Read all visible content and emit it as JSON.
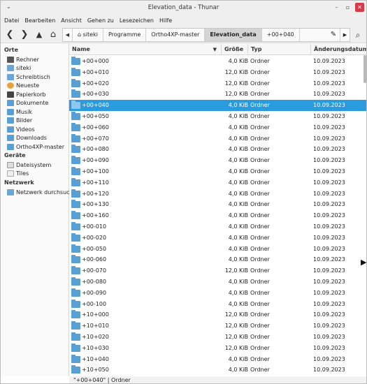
{
  "window": {
    "title": "Elevation_data - Thunar"
  },
  "menu": [
    "Datei",
    "Bearbeiten",
    "Ansicht",
    "Gehen zu",
    "Lesezeichen",
    "Hilfe"
  ],
  "toolbar": {
    "back_icon": "back-icon",
    "forward_icon": "forward-icon",
    "up_icon": "up-icon",
    "home_icon": "home-icon",
    "path": [
      {
        "label": "siteki",
        "icon": "home-small-icon"
      },
      {
        "label": "Programme"
      },
      {
        "label": "Ortho4XP-master"
      },
      {
        "label": "Elevation_data",
        "active": true
      },
      {
        "label": "+00+040"
      }
    ],
    "search_icon": "search-icon"
  },
  "sidebar": {
    "sections": [
      {
        "title": "Orte",
        "items": [
          {
            "label": "Rechner",
            "icon": "computer-icon"
          },
          {
            "label": "siteki",
            "icon": "home-folder-icon"
          },
          {
            "label": "Schreibtisch",
            "icon": "desktop-icon"
          },
          {
            "label": "Neueste",
            "icon": "recent-icon"
          },
          {
            "label": "Papierkorb",
            "icon": "trash-icon"
          },
          {
            "label": "Dokumente",
            "icon": "folder-icon"
          },
          {
            "label": "Musik",
            "icon": "folder-icon"
          },
          {
            "label": "Bilder",
            "icon": "folder-icon"
          },
          {
            "label": "Videos",
            "icon": "folder-icon"
          },
          {
            "label": "Downloads",
            "icon": "folder-icon"
          },
          {
            "label": "Ortho4XP-master",
            "icon": "folder-icon"
          }
        ]
      },
      {
        "title": "Geräte",
        "items": [
          {
            "label": "Dateisystem",
            "icon": "drive-icon"
          },
          {
            "label": "Tiles",
            "icon": "drive-icon"
          }
        ]
      },
      {
        "title": "Netzwerk",
        "items": [
          {
            "label": "Netzwerk durchsuc...",
            "icon": "network-icon"
          }
        ]
      }
    ]
  },
  "columns": [
    "Name",
    "Größe",
    "Typ",
    "Änderungsdatum"
  ],
  "rows": [
    {
      "name": "+00+000",
      "size": "4,0 KiB",
      "type": "Ordner",
      "date": "10.09.2023"
    },
    {
      "name": "+00+010",
      "size": "12,0 KiB",
      "type": "Ordner",
      "date": "10.09.2023"
    },
    {
      "name": "+00+020",
      "size": "12,0 KiB",
      "type": "Ordner",
      "date": "10.09.2023"
    },
    {
      "name": "+00+030",
      "size": "12,0 KiB",
      "type": "Ordner",
      "date": "10.09.2023"
    },
    {
      "name": "+00+040",
      "size": "4,0 KiB",
      "type": "Ordner",
      "date": "10.09.2023",
      "selected": true
    },
    {
      "name": "+00+050",
      "size": "4,0 KiB",
      "type": "Ordner",
      "date": "10.09.2023"
    },
    {
      "name": "+00+060",
      "size": "4,0 KiB",
      "type": "Ordner",
      "date": "10.09.2023"
    },
    {
      "name": "+00+070",
      "size": "4,0 KiB",
      "type": "Ordner",
      "date": "10.09.2023"
    },
    {
      "name": "+00+080",
      "size": "4,0 KiB",
      "type": "Ordner",
      "date": "10.09.2023"
    },
    {
      "name": "+00+090",
      "size": "4,0 KiB",
      "type": "Ordner",
      "date": "10.09.2023"
    },
    {
      "name": "+00+100",
      "size": "4,0 KiB",
      "type": "Ordner",
      "date": "10.09.2023"
    },
    {
      "name": "+00+110",
      "size": "4,0 KiB",
      "type": "Ordner",
      "date": "10.09.2023"
    },
    {
      "name": "+00+120",
      "size": "4,0 KiB",
      "type": "Ordner",
      "date": "10.09.2023"
    },
    {
      "name": "+00+130",
      "size": "4,0 KiB",
      "type": "Ordner",
      "date": "10.09.2023"
    },
    {
      "name": "+00+160",
      "size": "4,0 KiB",
      "type": "Ordner",
      "date": "10.09.2023"
    },
    {
      "name": "+00-010",
      "size": "4,0 KiB",
      "type": "Ordner",
      "date": "10.09.2023"
    },
    {
      "name": "+00-020",
      "size": "4,0 KiB",
      "type": "Ordner",
      "date": "10.09.2023"
    },
    {
      "name": "+00-050",
      "size": "4,0 KiB",
      "type": "Ordner",
      "date": "10.09.2023"
    },
    {
      "name": "+00-060",
      "size": "4,0 KiB",
      "type": "Ordner",
      "date": "10.09.2023"
    },
    {
      "name": "+00-070",
      "size": "12,0 KiB",
      "type": "Ordner",
      "date": "10.09.2023"
    },
    {
      "name": "+00-080",
      "size": "4,0 KiB",
      "type": "Ordner",
      "date": "10.09.2023"
    },
    {
      "name": "+00-090",
      "size": "4,0 KiB",
      "type": "Ordner",
      "date": "10.09.2023"
    },
    {
      "name": "+00-100",
      "size": "4,0 KiB",
      "type": "Ordner",
      "date": "10.09.2023"
    },
    {
      "name": "+10+000",
      "size": "12,0 KiB",
      "type": "Ordner",
      "date": "10.09.2023"
    },
    {
      "name": "+10+010",
      "size": "12,0 KiB",
      "type": "Ordner",
      "date": "10.09.2023"
    },
    {
      "name": "+10+020",
      "size": "12,0 KiB",
      "type": "Ordner",
      "date": "10.09.2023"
    },
    {
      "name": "+10+030",
      "size": "12,0 KiB",
      "type": "Ordner",
      "date": "10.09.2023"
    },
    {
      "name": "+10+040",
      "size": "4,0 KiB",
      "type": "Ordner",
      "date": "10.09.2023"
    },
    {
      "name": "+10+050",
      "size": "4,0 KiB",
      "type": "Ordner",
      "date": "10.09.2023"
    }
  ],
  "status": {
    "text": "\"+00+040\"  |  Ordner"
  }
}
